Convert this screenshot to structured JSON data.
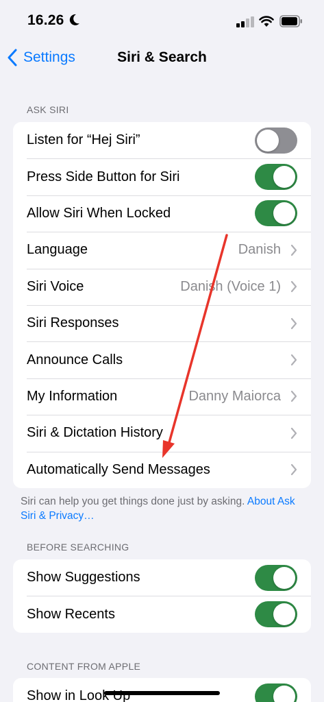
{
  "status_bar": {
    "time": "16.26"
  },
  "nav": {
    "back_label": "Settings",
    "title": "Siri & Search"
  },
  "ask_siri": {
    "header": "ASK SIRI",
    "rows": [
      {
        "label": "Listen for “Hej Siri”",
        "toggle": false
      },
      {
        "label": "Press Side Button for Siri",
        "toggle": true
      },
      {
        "label": "Allow Siri When Locked",
        "toggle": true
      },
      {
        "label": "Language",
        "value": "Danish"
      },
      {
        "label": "Siri Voice",
        "value": "Danish (Voice 1)"
      },
      {
        "label": "Siri Responses",
        "value": ""
      },
      {
        "label": "Announce Calls",
        "value": ""
      },
      {
        "label": "My Information",
        "value": "Danny Maiorca"
      },
      {
        "label": "Siri & Dictation History",
        "value": ""
      },
      {
        "label": "Automatically Send Messages",
        "value": ""
      }
    ],
    "footer_text": "Siri can help you get things done just by asking.",
    "footer_link": "About Ask Siri & Privacy…"
  },
  "before_searching": {
    "header": "BEFORE SEARCHING",
    "rows": [
      {
        "label": "Show Suggestions",
        "toggle": true
      },
      {
        "label": "Show Recents",
        "toggle": true
      }
    ]
  },
  "content_from_apple": {
    "header": "CONTENT FROM APPLE",
    "rows": [
      {
        "label": "Show in Look Up",
        "toggle": true
      }
    ]
  },
  "colors": {
    "accent": "#0a7aff",
    "toggle_on": "#2e8a45",
    "toggle_off": "#8e8e93",
    "annotation_arrow": "#e8352b"
  }
}
